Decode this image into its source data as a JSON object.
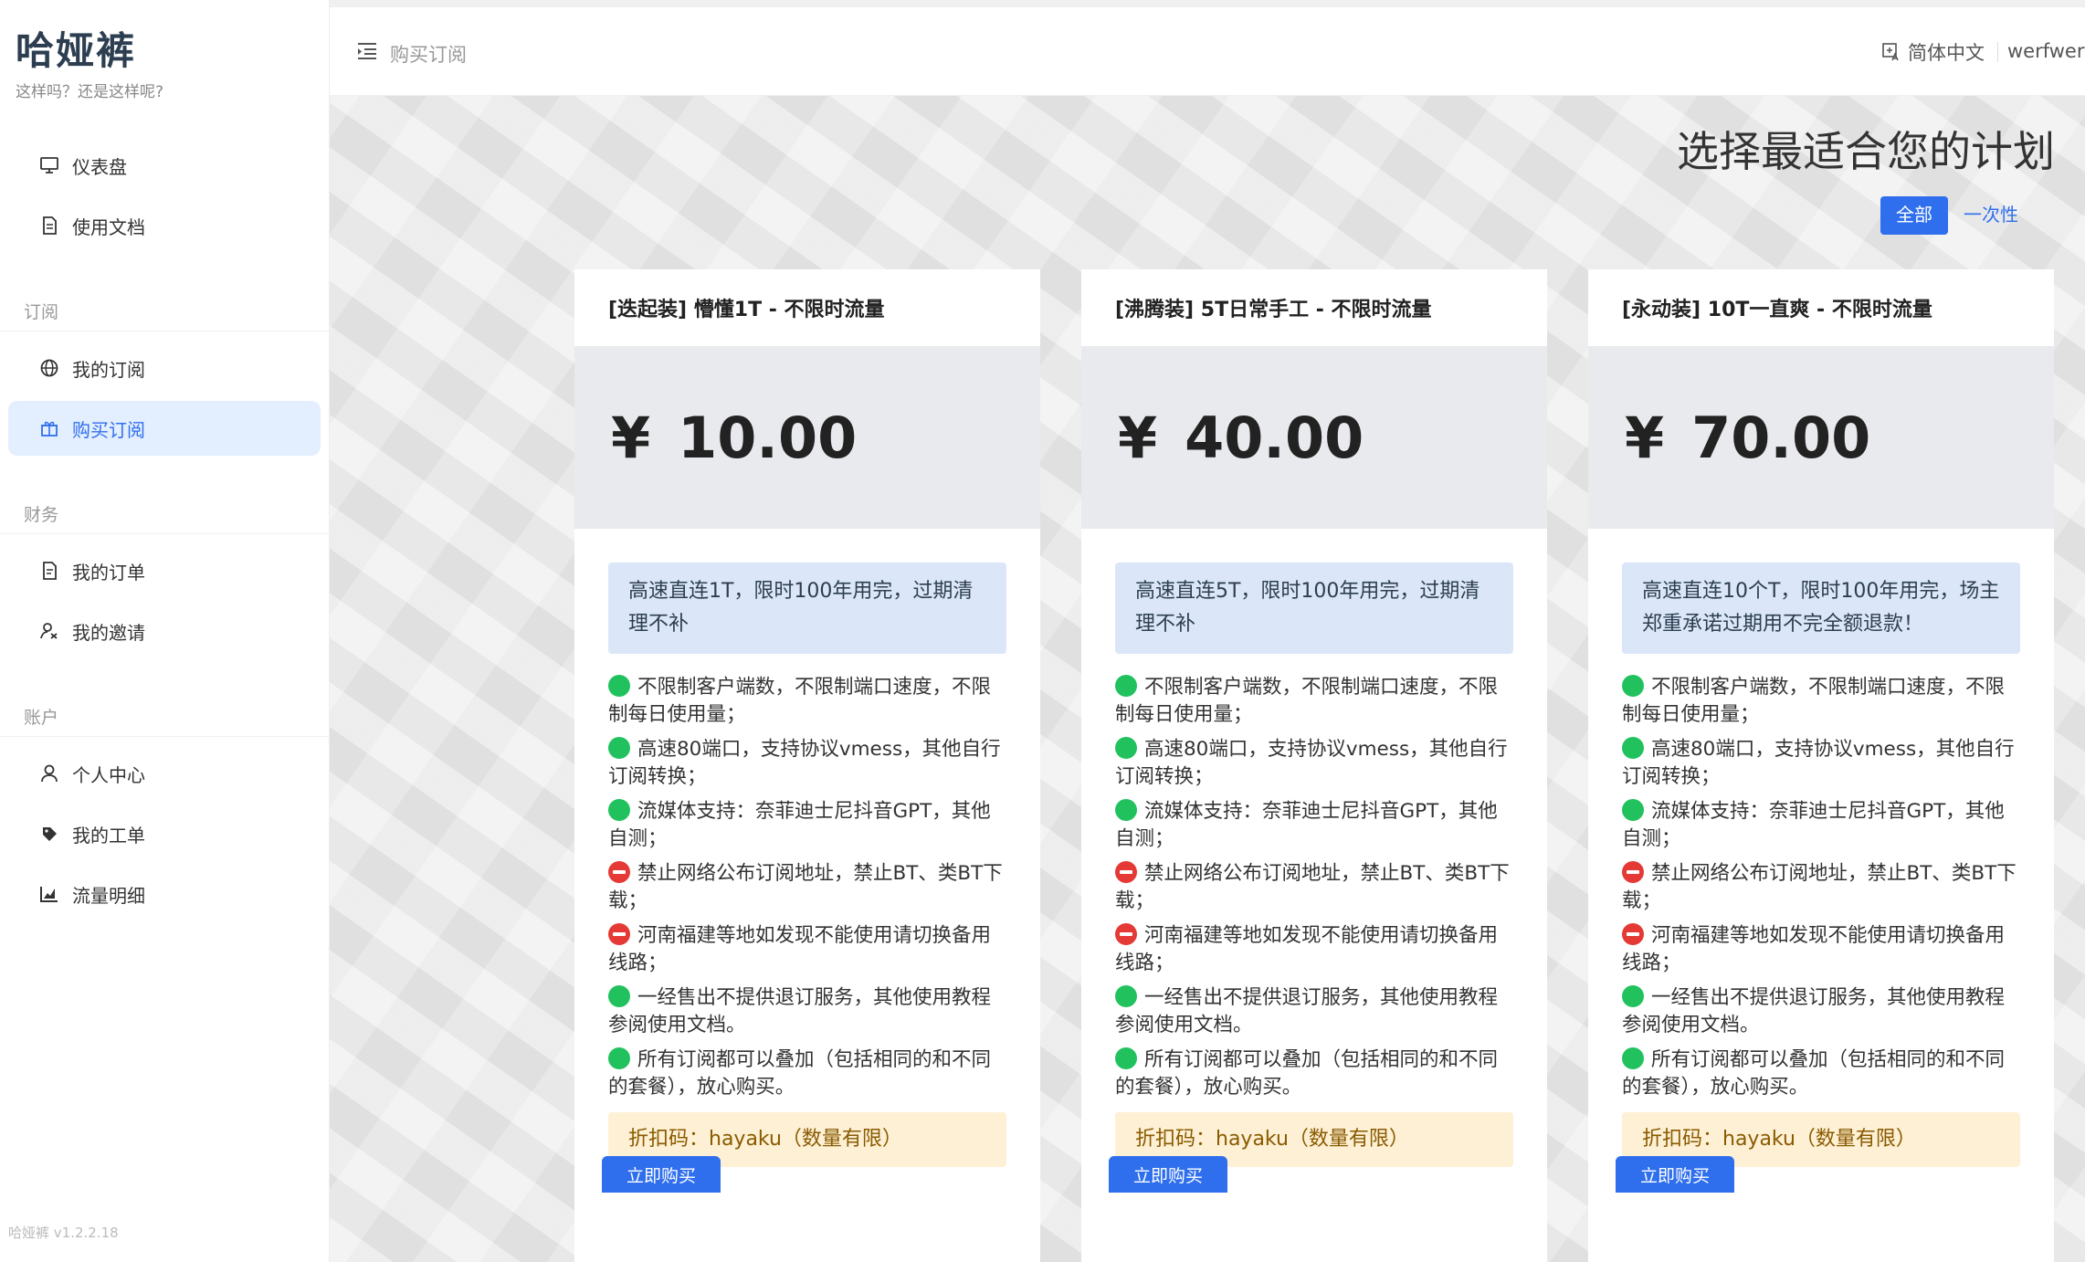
{
  "brand": {
    "title": "哈娅裤",
    "subtitle": "这样吗？还是这样呢?"
  },
  "sidebar": {
    "items_top": [
      {
        "label": "仪表盘",
        "icon": "monitor-icon"
      },
      {
        "label": "使用文档",
        "icon": "document-icon"
      }
    ],
    "sections": [
      {
        "title": "订阅",
        "items": [
          {
            "label": "我的订阅",
            "icon": "globe-icon"
          },
          {
            "label": "购买订阅",
            "icon": "gift-icon",
            "active": true
          }
        ]
      },
      {
        "title": "财务",
        "items": [
          {
            "label": "我的订单",
            "icon": "order-icon"
          },
          {
            "label": "我的邀请",
            "icon": "invite-icon"
          }
        ]
      },
      {
        "title": "账户",
        "items": [
          {
            "label": "个人中心",
            "icon": "user-icon"
          },
          {
            "label": "我的工单",
            "icon": "ticket-icon"
          },
          {
            "label": "流量明细",
            "icon": "chart-icon"
          }
        ]
      }
    ],
    "version": "哈娅裤  v1.2.2.18"
  },
  "header": {
    "breadcrumb": "购买订阅",
    "language": "简体中文",
    "user": "werfwerf"
  },
  "main": {
    "heading": "选择最适合您的计划",
    "toggle": {
      "all": "全部",
      "one_time": "一次性"
    },
    "plans": [
      {
        "title": "[迭起装] 懵懂1T - 不限时流量",
        "currency": "¥",
        "price": "10.00",
        "desc": "高速直连1T，限时100年用完，过期清理不补",
        "features": [
          {
            "ok": true,
            "text": "不限制客户端数，不限制端口速度，不限制每日使用量；"
          },
          {
            "ok": true,
            "text": "高速80端口，支持协议vmess，其他自行订阅转换；"
          },
          {
            "ok": true,
            "text": "流媒体支持：奈菲迪士尼抖音GPT，其他自测；"
          },
          {
            "ok": false,
            "text": "禁止网络公布订阅地址，禁止BT、类BT下载；"
          },
          {
            "ok": false,
            "text": "河南福建等地如发现不能使用请切换备用线路；"
          },
          {
            "ok": true,
            "text": "一经售出不提供退订服务，其他使用教程参阅使用文档。"
          },
          {
            "ok": true,
            "text": "所有订阅都可以叠加（包括相同的和不同的套餐），放心购买。"
          }
        ],
        "coupon": "折扣码：hayaku（数量有限）",
        "buy": "立即购买"
      },
      {
        "title": "[沸腾装] 5T日常手工 - 不限时流量",
        "currency": "¥",
        "price": "40.00",
        "desc": "高速直连5T，限时100年用完，过期清理不补",
        "features": [
          {
            "ok": true,
            "text": "不限制客户端数，不限制端口速度，不限制每日使用量；"
          },
          {
            "ok": true,
            "text": "高速80端口，支持协议vmess，其他自行订阅转换；"
          },
          {
            "ok": true,
            "text": "流媒体支持：奈菲迪士尼抖音GPT，其他自测；"
          },
          {
            "ok": false,
            "text": "禁止网络公布订阅地址，禁止BT、类BT下载；"
          },
          {
            "ok": false,
            "text": "河南福建等地如发现不能使用请切换备用线路；"
          },
          {
            "ok": true,
            "text": "一经售出不提供退订服务，其他使用教程参阅使用文档。"
          },
          {
            "ok": true,
            "text": "所有订阅都可以叠加（包括相同的和不同的套餐），放心购买。"
          }
        ],
        "coupon": "折扣码：hayaku（数量有限）",
        "buy": "立即购买"
      },
      {
        "title": "[永动装] 10T一直爽 - 不限时流量",
        "currency": "¥",
        "price": "70.00",
        "desc": "高速直连10个T，限时100年用完，场主郑重承诺过期用不完全额退款！",
        "features": [
          {
            "ok": true,
            "text": "不限制客户端数，不限制端口速度，不限制每日使用量；"
          },
          {
            "ok": true,
            "text": "高速80端口，支持协议vmess，其他自行订阅转换；"
          },
          {
            "ok": true,
            "text": "流媒体支持：奈菲迪士尼抖音GPT，其他自测；"
          },
          {
            "ok": false,
            "text": "禁止网络公布订阅地址，禁止BT、类BT下载；"
          },
          {
            "ok": false,
            "text": "河南福建等地如发现不能使用请切换备用线路；"
          },
          {
            "ok": true,
            "text": "一经售出不提供退订服务，其他使用教程参阅使用文档。"
          },
          {
            "ok": true,
            "text": "所有订阅都可以叠加（包括相同的和不同的套餐），放心购买。"
          }
        ],
        "coupon": "折扣码：hayaku（数量有限）",
        "buy": "立即购买"
      }
    ]
  },
  "colors": {
    "accent": "#2f6fed",
    "ok": "#21c25e",
    "no": "#e53935"
  }
}
